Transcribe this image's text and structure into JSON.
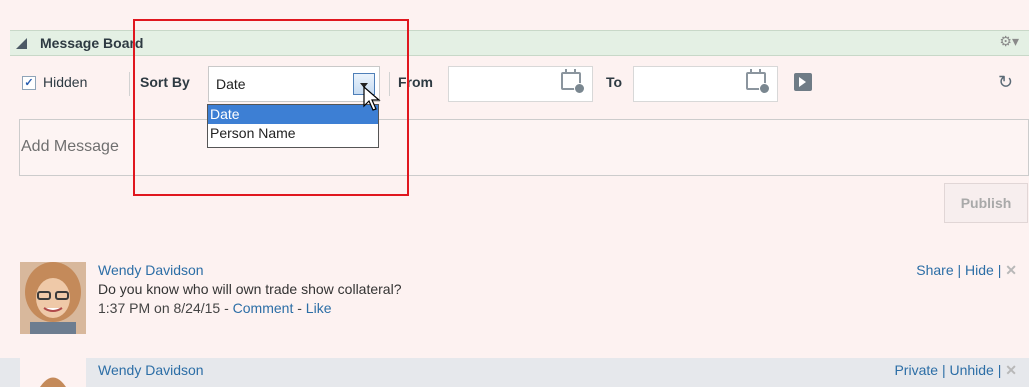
{
  "header": {
    "title": "Message Board",
    "gear_icon": "gear-icon"
  },
  "toolbar": {
    "hidden_label": "Hidden",
    "hidden_checked": true,
    "sort_by_label": "Sort By",
    "sort_value": "Date",
    "from_label": "From",
    "to_label": "To",
    "from_value": "",
    "to_value": ""
  },
  "sort_options": [
    "Date",
    "Person Name"
  ],
  "composer": {
    "placeholder": "Add Message",
    "publish_label": "Publish"
  },
  "posts": [
    {
      "author": "Wendy Davidson",
      "message": "Do you know who will own trade show collateral?",
      "time": "1:37 PM on 8/24/15",
      "comment": "Comment",
      "like": "Like",
      "action1": "Share",
      "action2": "Hide",
      "sep": "-",
      "bar": "|"
    },
    {
      "author": "Wendy Davidson",
      "action1": "Private",
      "action2": "Unhide",
      "bar": "|"
    }
  ]
}
